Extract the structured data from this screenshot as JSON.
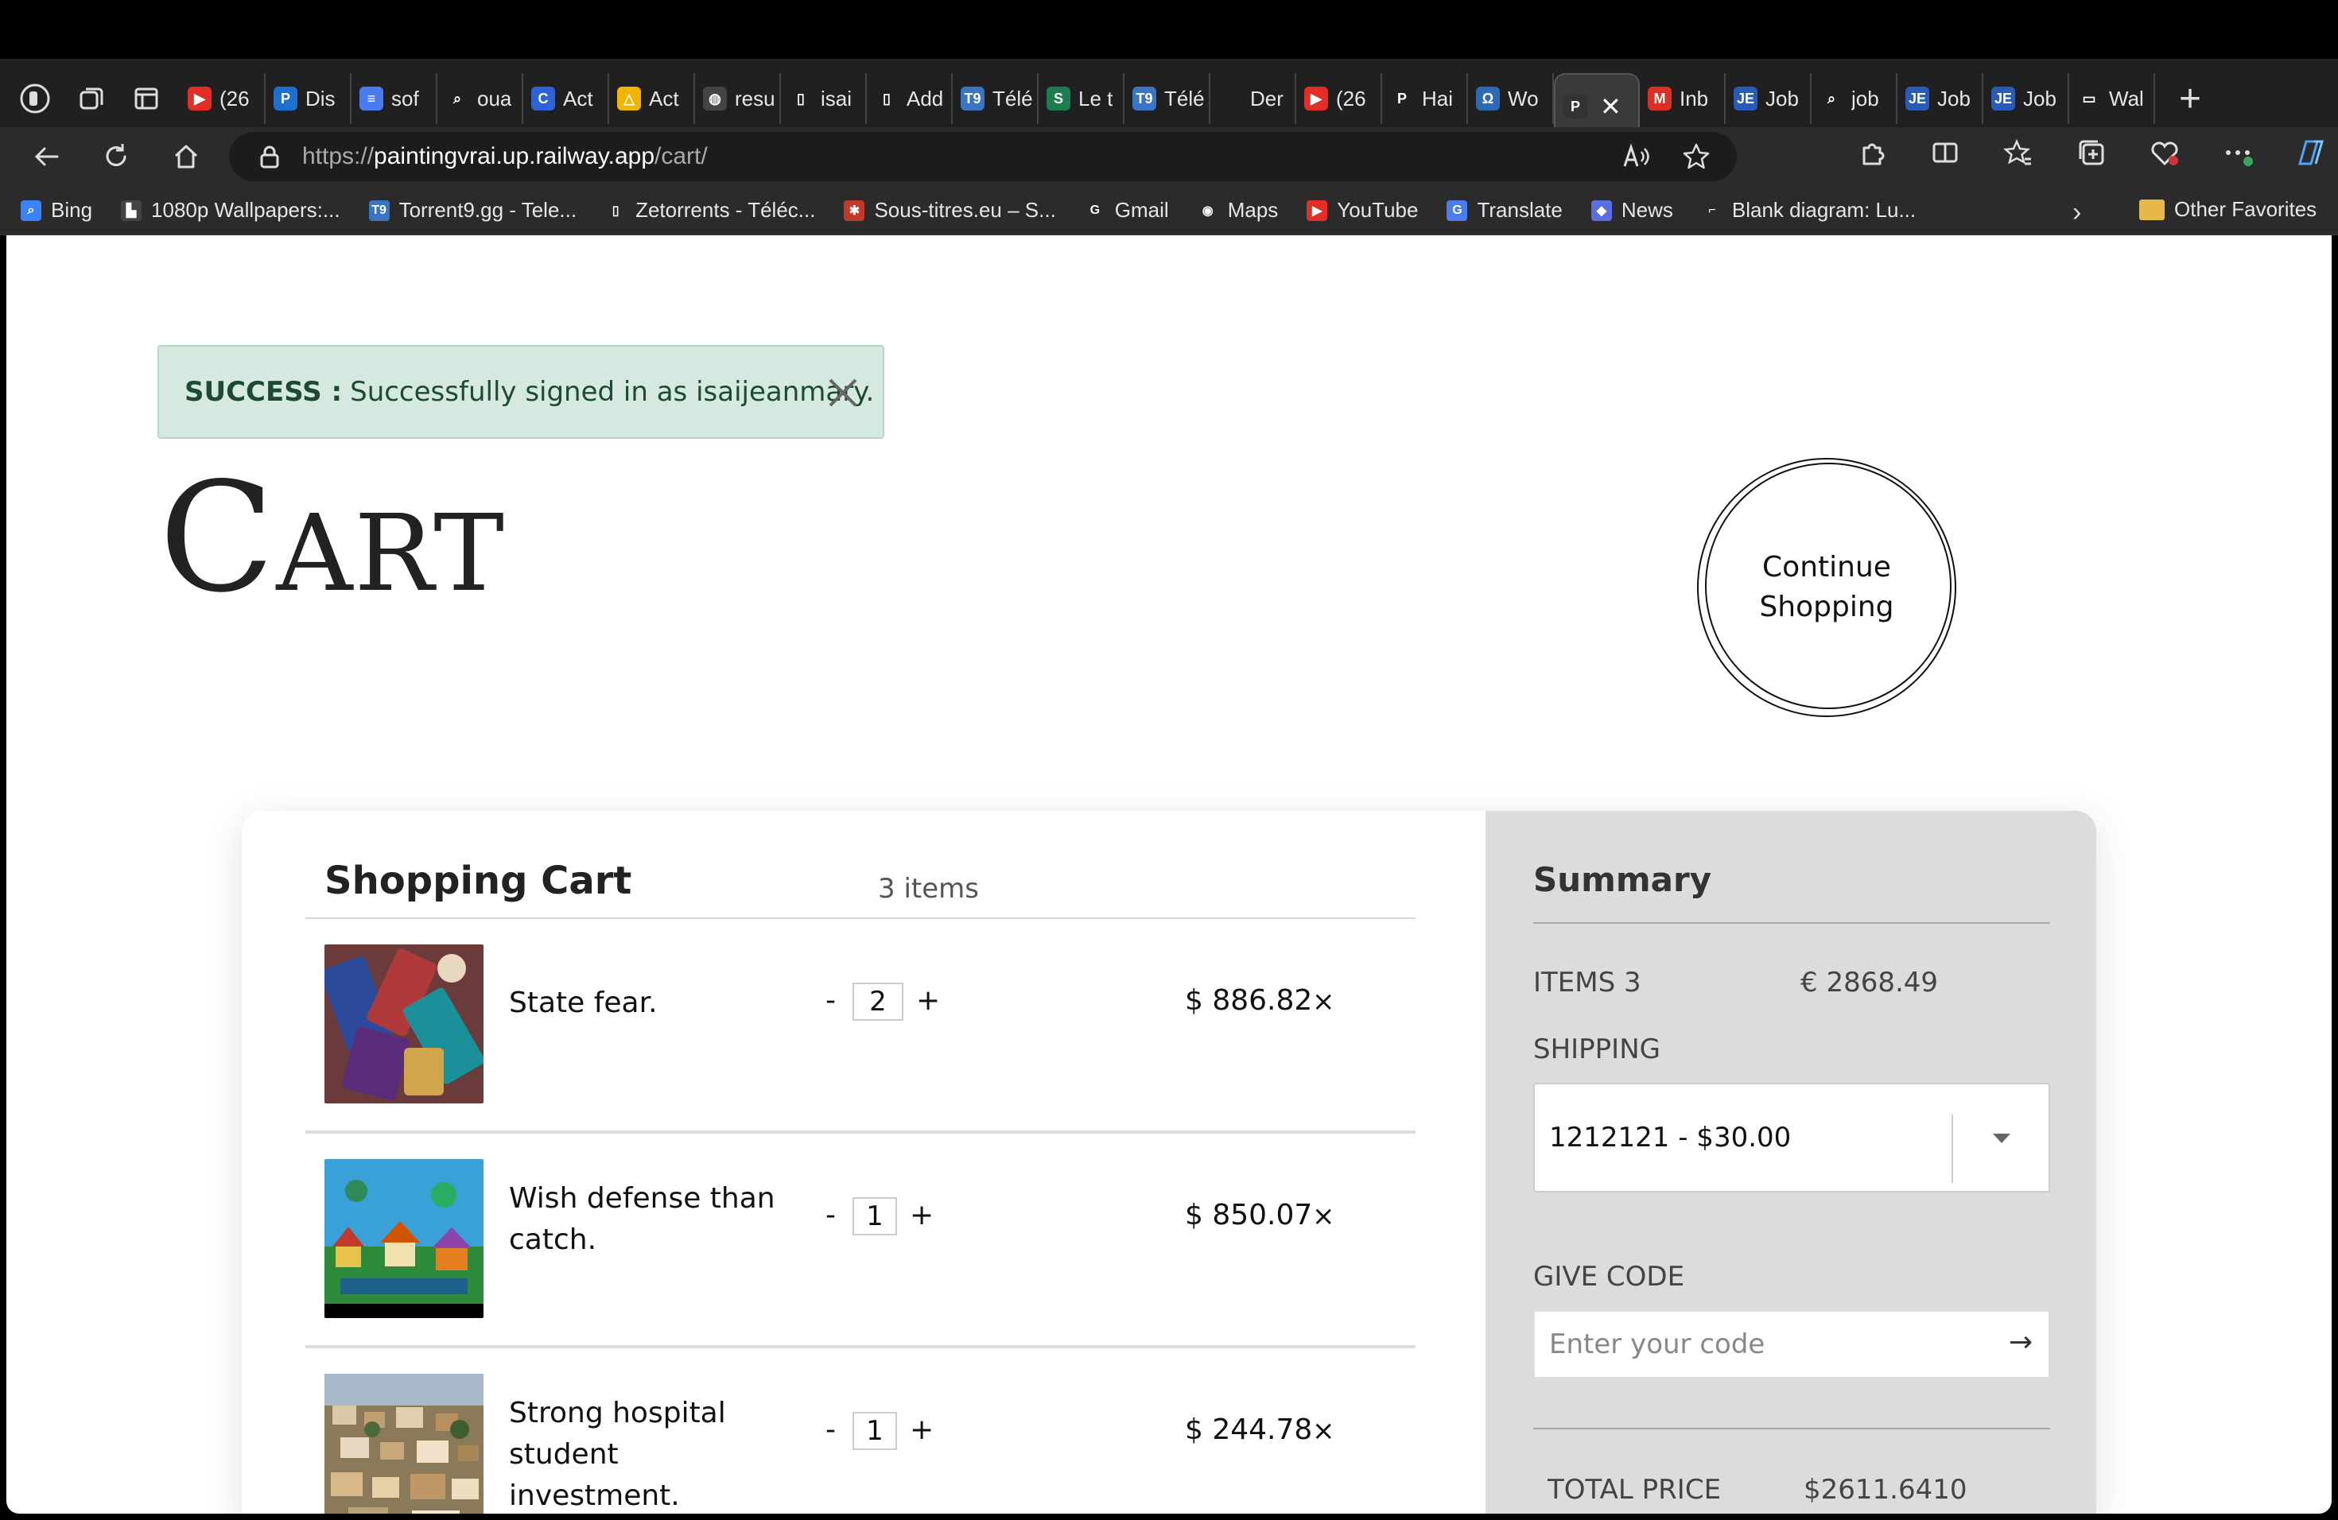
{
  "browser": {
    "tabs": [
      {
        "label": "(26",
        "icon": "youtube-icon",
        "color": "#e52d27",
        "glyph": "▶"
      },
      {
        "label": "Dis",
        "icon": "p-icon",
        "color": "#1f6fd1",
        "glyph": "P"
      },
      {
        "label": "sof",
        "icon": "docs-icon",
        "color": "#4a7cf0",
        "glyph": "≡"
      },
      {
        "label": "oua",
        "icon": "search-icon",
        "color": "#202020",
        "glyph": "⌕"
      },
      {
        "label": "Act",
        "icon": "c-icon",
        "color": "#2e63d8",
        "glyph": "C"
      },
      {
        "label": "Act",
        "icon": "drive-icon",
        "color": "#f1b400",
        "glyph": "△"
      },
      {
        "label": "resu",
        "icon": "globe-icon",
        "color": "#444",
        "glyph": "◍"
      },
      {
        "label": "isai",
        "icon": "page-icon",
        "color": "#202020",
        "glyph": "▯"
      },
      {
        "label": "Add",
        "icon": "page-icon",
        "color": "#202020",
        "glyph": "▯"
      },
      {
        "label": "Télé",
        "icon": "t9-icon",
        "color": "#3a75c4",
        "glyph": "T9"
      },
      {
        "label": "Le t",
        "icon": "s-icon",
        "color": "#1e7d4f",
        "glyph": "S"
      },
      {
        "label": "Télé",
        "icon": "t9-icon",
        "color": "#3a75c4",
        "glyph": "T9"
      },
      {
        "label": "Der",
        "icon": "blank-icon",
        "color": "#202020",
        "glyph": ""
      },
      {
        "label": "(26",
        "icon": "youtube-icon",
        "color": "#e52d27",
        "glyph": "▶"
      },
      {
        "label": "Hai",
        "icon": "p-dark-icon",
        "color": "#202020",
        "glyph": "P"
      },
      {
        "label": "Wo",
        "icon": "headphones-icon",
        "color": "#2c6bb3",
        "glyph": "Ω"
      }
    ],
    "active_tab": {
      "label": "",
      "icon": "painting-icon",
      "close": "✕"
    },
    "tabs_after": [
      {
        "label": "Inb",
        "icon": "gmail-icon",
        "color": "#d93025",
        "glyph": "M"
      },
      {
        "label": "Job",
        "icon": "je-icon",
        "color": "#2a5bb7",
        "glyph": "JE"
      },
      {
        "label": "job",
        "icon": "search-icon",
        "color": "#202020",
        "glyph": "⌕"
      },
      {
        "label": "Job",
        "icon": "je-icon",
        "color": "#2a5bb7",
        "glyph": "JE"
      },
      {
        "label": "Job",
        "icon": "je-icon",
        "color": "#2a5bb7",
        "glyph": "JE"
      },
      {
        "label": "Wal",
        "icon": "wallet-icon",
        "color": "#202020",
        "glyph": "▭"
      }
    ],
    "new_tab": "+",
    "url": {
      "scheme": "https://",
      "host": "paintingvrai.up.railway.app",
      "path": "/cart/"
    },
    "bookmarks": [
      {
        "label": "Bing",
        "icon": "search-icon",
        "color": "#3b82f6",
        "glyph": "⌕"
      },
      {
        "label": "1080p Wallpapers:...",
        "icon": "wallpaper-icon",
        "color": "#444",
        "glyph": "▙"
      },
      {
        "label": "Torrent9.gg - Tele...",
        "icon": "t9-icon",
        "color": "#3a75c4",
        "glyph": "T9"
      },
      {
        "label": "Zetorrents - Téléc...",
        "icon": "page-icon",
        "color": "#2b2b2b",
        "glyph": "▯"
      },
      {
        "label": "Sous-titres.eu – S...",
        "icon": "star-red-icon",
        "color": "#c0392b",
        "glyph": "✱"
      },
      {
        "label": "Gmail",
        "icon": "google-icon",
        "color": "#2b2b2b",
        "glyph": "G"
      },
      {
        "label": "Maps",
        "icon": "maps-icon",
        "color": "#2b2b2b",
        "glyph": "◉"
      },
      {
        "label": "YouTube",
        "icon": "youtube-icon",
        "color": "#e52d27",
        "glyph": "▶"
      },
      {
        "label": "Translate",
        "icon": "translate-icon",
        "color": "#4a7cf0",
        "glyph": "G"
      },
      {
        "label": "News",
        "icon": "news-icon",
        "color": "#5b6ee1",
        "glyph": "◆"
      },
      {
        "label": "Blank diagram: Lu...",
        "icon": "lucid-icon",
        "color": "#2b2b2b",
        "glyph": "⌐"
      }
    ],
    "bookmarks_more": "›",
    "other_favorites": "Other Favorites"
  },
  "alert": {
    "prefix": "SUCCESS :",
    "message": "Successfully signed in as isaijeanmary."
  },
  "page_title": "Cart",
  "continue_button": "Continue Shopping",
  "cart": {
    "heading": "Shopping Cart",
    "count": "3 items",
    "items": [
      {
        "name": "State fear.",
        "qty": "2",
        "price": "$ 886.82",
        "minus": "-",
        "plus": "+",
        "remove": "×"
      },
      {
        "name": "Wish defense than catch.",
        "qty": "1",
        "price": "$ 850.07",
        "minus": "-",
        "plus": "+",
        "remove": "×"
      },
      {
        "name": "Strong hospital student investment.",
        "qty": "1",
        "price": "$ 244.78",
        "minus": "-",
        "plus": "+",
        "remove": "×"
      }
    ]
  },
  "summary": {
    "heading": "Summary",
    "items_label": "ITEMS 3",
    "items_value": "€ 2868.49",
    "shipping_label": "SHIPPING",
    "shipping_option": "1212121 - $30.00",
    "code_label": "GIVE CODE",
    "code_placeholder": "Enter your code",
    "code_submit": "→",
    "total_label": "TOTAL PRICE",
    "total_value": "$2611.6410"
  }
}
